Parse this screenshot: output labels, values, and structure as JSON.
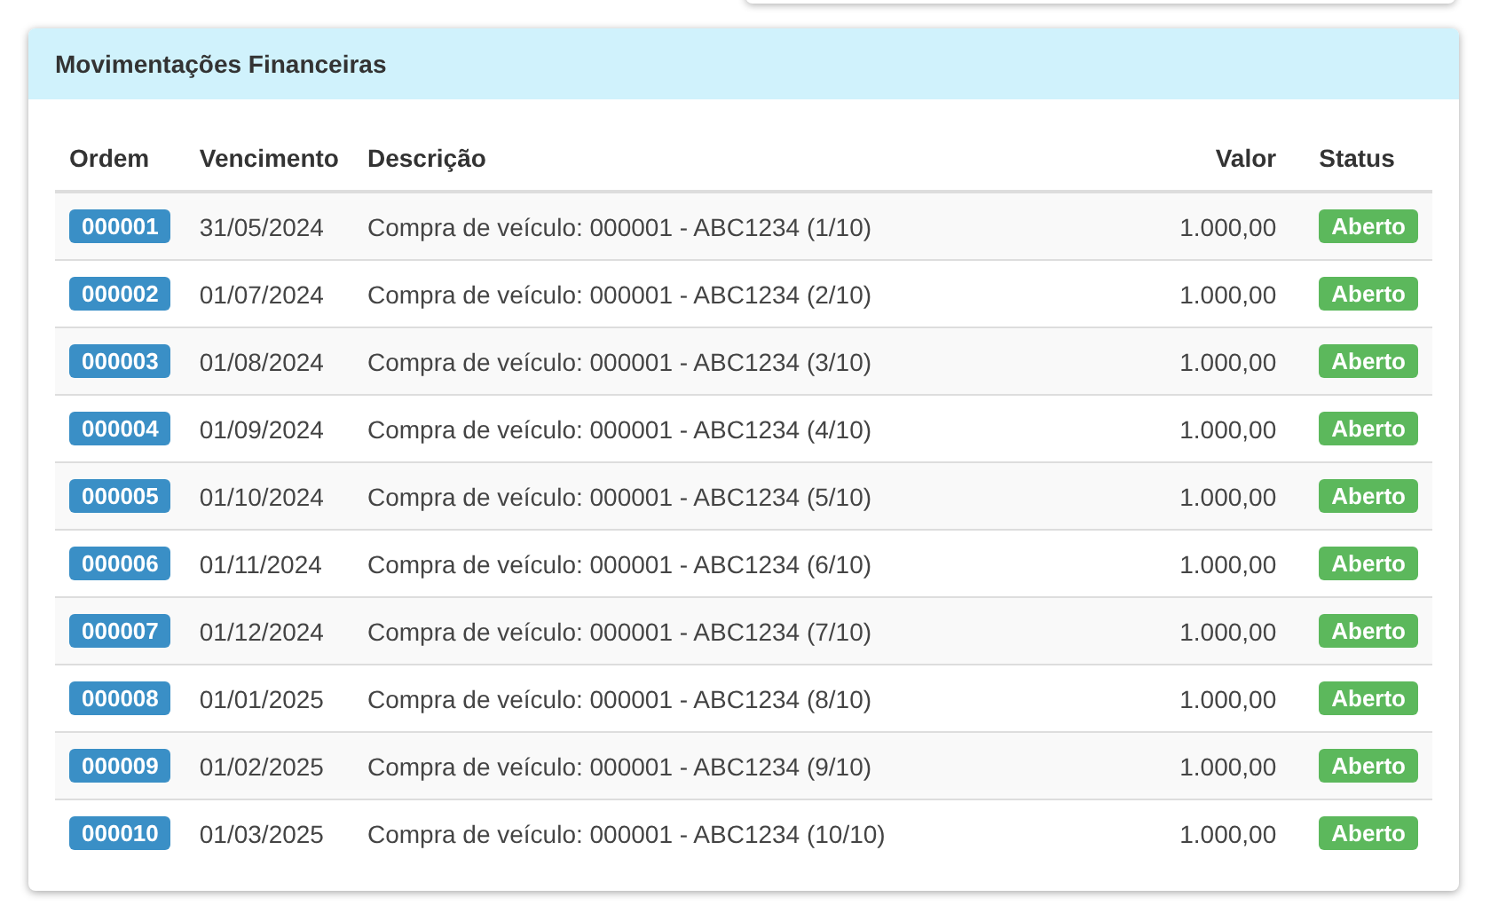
{
  "panel": {
    "title": "Movimentações Financeiras"
  },
  "table": {
    "columns": [
      "Ordem",
      "Vencimento",
      "Descrição",
      "Valor",
      "Status"
    ],
    "rows": [
      {
        "order": "000001",
        "due": "31/05/2024",
        "description": "Compra de veículo: 000001 - ABC1234 (1/10)",
        "value": "1.000,00",
        "status": "Aberto"
      },
      {
        "order": "000002",
        "due": "01/07/2024",
        "description": "Compra de veículo: 000001 - ABC1234 (2/10)",
        "value": "1.000,00",
        "status": "Aberto"
      },
      {
        "order": "000003",
        "due": "01/08/2024",
        "description": "Compra de veículo: 000001 - ABC1234 (3/10)",
        "value": "1.000,00",
        "status": "Aberto"
      },
      {
        "order": "000004",
        "due": "01/09/2024",
        "description": "Compra de veículo: 000001 - ABC1234 (4/10)",
        "value": "1.000,00",
        "status": "Aberto"
      },
      {
        "order": "000005",
        "due": "01/10/2024",
        "description": "Compra de veículo: 000001 - ABC1234 (5/10)",
        "value": "1.000,00",
        "status": "Aberto"
      },
      {
        "order": "000006",
        "due": "01/11/2024",
        "description": "Compra de veículo: 000001 - ABC1234 (6/10)",
        "value": "1.000,00",
        "status": "Aberto"
      },
      {
        "order": "000007",
        "due": "01/12/2024",
        "description": "Compra de veículo: 000001 - ABC1234 (7/10)",
        "value": "1.000,00",
        "status": "Aberto"
      },
      {
        "order": "000008",
        "due": "01/01/2025",
        "description": "Compra de veículo: 000001 - ABC1234 (8/10)",
        "value": "1.000,00",
        "status": "Aberto"
      },
      {
        "order": "000009",
        "due": "01/02/2025",
        "description": "Compra de veículo: 000001 - ABC1234 (9/10)",
        "value": "1.000,00",
        "status": "Aberto"
      },
      {
        "order": "000010",
        "due": "01/03/2025",
        "description": "Compra de veículo: 000001 - ABC1234 (10/10)",
        "value": "1.000,00",
        "status": "Aberto"
      }
    ]
  }
}
